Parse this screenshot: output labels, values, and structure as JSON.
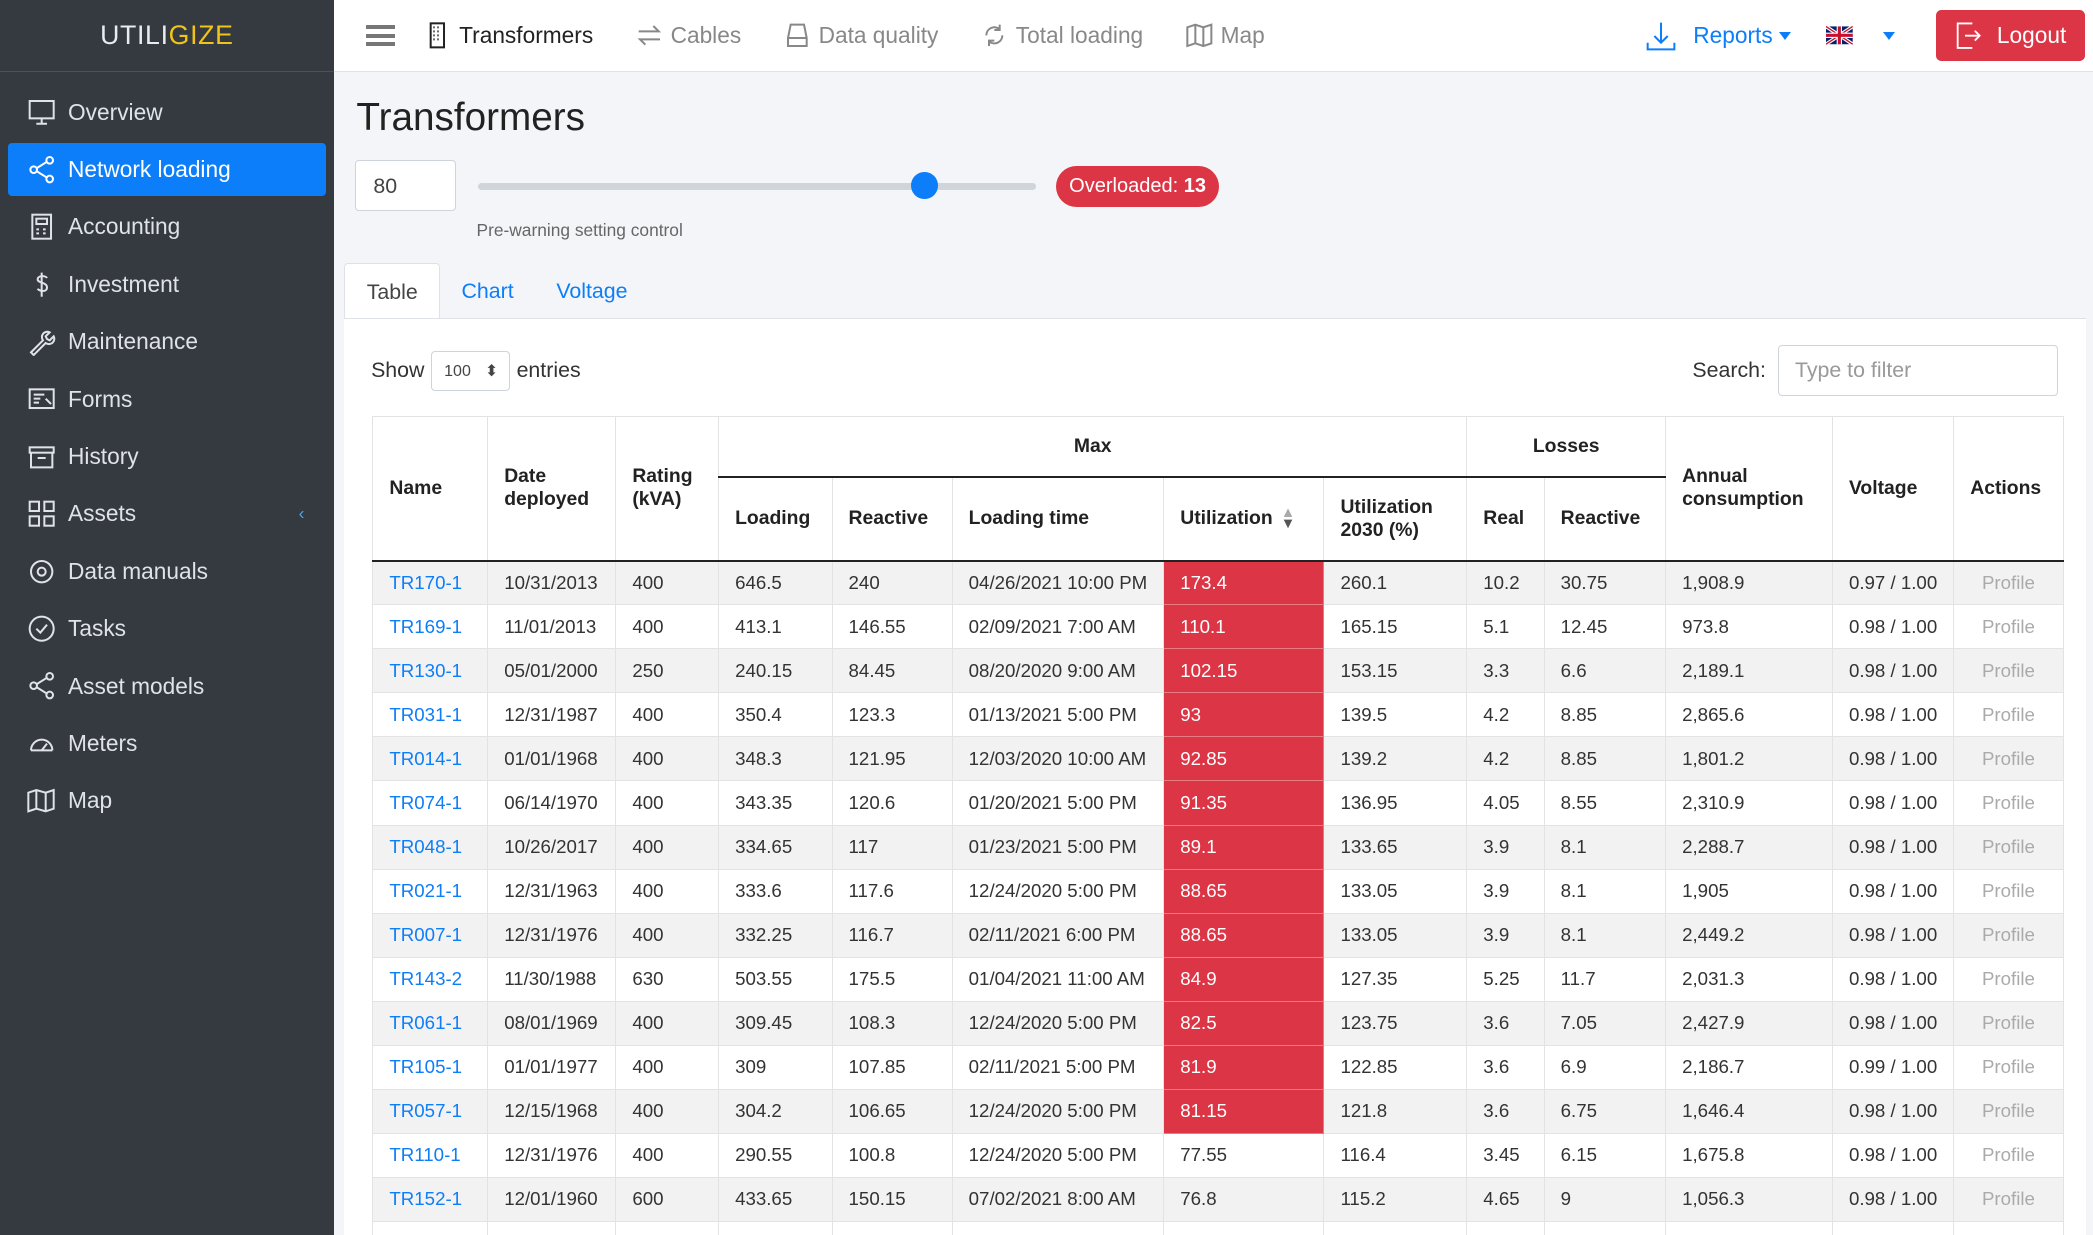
{
  "brand": {
    "part1": "UTILI",
    "part2": "GIZE"
  },
  "sidebar": {
    "items": [
      {
        "label": "Overview",
        "icon": "monitor-icon"
      },
      {
        "label": "Network loading",
        "icon": "share-nodes-icon",
        "active": true
      },
      {
        "label": "Accounting",
        "icon": "calculator-icon"
      },
      {
        "label": "Investment",
        "icon": "dollar-icon"
      },
      {
        "label": "Maintenance",
        "icon": "wrench-icon"
      },
      {
        "label": "Forms",
        "icon": "form-icon"
      },
      {
        "label": "History",
        "icon": "archive-icon"
      },
      {
        "label": "Assets",
        "icon": "grid-icon",
        "chevron": "‹"
      },
      {
        "label": "Data manuals",
        "icon": "gear-icon"
      },
      {
        "label": "Tasks",
        "icon": "check-circle-icon"
      },
      {
        "label": "Asset models",
        "icon": "share-nodes-icon"
      },
      {
        "label": "Meters",
        "icon": "gauge-icon"
      },
      {
        "label": "Map",
        "icon": "map-icon"
      }
    ]
  },
  "topnav": {
    "items": [
      {
        "label": "Transformers",
        "active": true
      },
      {
        "label": "Cables"
      },
      {
        "label": "Data quality"
      },
      {
        "label": "Total loading"
      },
      {
        "label": "Map"
      }
    ],
    "reports": "Reports",
    "language": "en-GB",
    "logout": "Logout"
  },
  "colors": {
    "accent": "#0d7ef9",
    "danger": "#dc3545",
    "sidebar": "#343a40"
  },
  "page": {
    "title": "Transformers",
    "threshold": "80",
    "slider_value": 80,
    "slider_max": 100,
    "overloaded_label": "Overloaded:",
    "overloaded_count": "13",
    "hint": "Pre-warning setting control",
    "tabs": [
      "Table",
      "Chart",
      "Voltage"
    ]
  },
  "table_controls": {
    "show": "Show",
    "entries_value": "100",
    "entries": "entries",
    "search_label": "Search:",
    "search_placeholder": "Type to filter"
  },
  "table": {
    "headers": {
      "name": "Name",
      "date": "Date deployed",
      "rating": "Rating (kVA)",
      "max": "Max",
      "loading": "Loading",
      "reactive": "Reactive",
      "loading_time": "Loading time",
      "utilization": "Utilization",
      "util2030": "Utilization 2030 (%)",
      "losses": "Losses",
      "real": "Real",
      "losses_reactive": "Reactive",
      "annual": "Annual consumption",
      "voltage": "Voltage",
      "actions": "Actions"
    },
    "rows": [
      [
        "TR170-1",
        "10/31/2013",
        "400",
        "646.5",
        "240",
        "04/26/2021 10:00 PM",
        "173.4",
        "260.1",
        "10.2",
        "30.75",
        "1,908.9",
        "0.97 / 1.00",
        "Profile"
      ],
      [
        "TR169-1",
        "11/01/2013",
        "400",
        "413.1",
        "146.55",
        "02/09/2021 7:00 AM",
        "110.1",
        "165.15",
        "5.1",
        "12.45",
        "973.8",
        "0.98 / 1.00",
        "Profile"
      ],
      [
        "TR130-1",
        "05/01/2000",
        "250",
        "240.15",
        "84.45",
        "08/20/2020 9:00 AM",
        "102.15",
        "153.15",
        "3.3",
        "6.6",
        "2,189.1",
        "0.98 / 1.00",
        "Profile"
      ],
      [
        "TR031-1",
        "12/31/1987",
        "400",
        "350.4",
        "123.3",
        "01/13/2021 5:00 PM",
        "93",
        "139.5",
        "4.2",
        "8.85",
        "2,865.6",
        "0.98 / 1.00",
        "Profile"
      ],
      [
        "TR014-1",
        "01/01/1968",
        "400",
        "348.3",
        "121.95",
        "12/03/2020 10:00 AM",
        "92.85",
        "139.2",
        "4.2",
        "8.85",
        "1,801.2",
        "0.98 / 1.00",
        "Profile"
      ],
      [
        "TR074-1",
        "06/14/1970",
        "400",
        "343.35",
        "120.6",
        "01/20/2021 5:00 PM",
        "91.35",
        "136.95",
        "4.05",
        "8.55",
        "2,310.9",
        "0.98 / 1.00",
        "Profile"
      ],
      [
        "TR048-1",
        "10/26/2017",
        "400",
        "334.65",
        "117",
        "01/23/2021 5:00 PM",
        "89.1",
        "133.65",
        "3.9",
        "8.1",
        "2,288.7",
        "0.98 / 1.00",
        "Profile"
      ],
      [
        "TR021-1",
        "12/31/1963",
        "400",
        "333.6",
        "117.6",
        "12/24/2020 5:00 PM",
        "88.65",
        "133.05",
        "3.9",
        "8.1",
        "1,905",
        "0.98 / 1.00",
        "Profile"
      ],
      [
        "TR007-1",
        "12/31/1976",
        "400",
        "332.25",
        "116.7",
        "02/11/2021 6:00 PM",
        "88.65",
        "133.05",
        "3.9",
        "8.1",
        "2,449.2",
        "0.98 / 1.00",
        "Profile"
      ],
      [
        "TR143-2",
        "11/30/1988",
        "630",
        "503.55",
        "175.5",
        "01/04/2021 11:00 AM",
        "84.9",
        "127.35",
        "5.25",
        "11.7",
        "2,031.3",
        "0.98 / 1.00",
        "Profile"
      ],
      [
        "TR061-1",
        "08/01/1969",
        "400",
        "309.45",
        "108.3",
        "12/24/2020 5:00 PM",
        "82.5",
        "123.75",
        "3.6",
        "7.05",
        "2,427.9",
        "0.98 / 1.00",
        "Profile"
      ],
      [
        "TR105-1",
        "01/01/1977",
        "400",
        "309",
        "107.85",
        "02/11/2021 5:00 PM",
        "81.9",
        "122.85",
        "3.6",
        "6.9",
        "2,186.7",
        "0.99 / 1.00",
        "Profile"
      ],
      [
        "TR057-1",
        "12/15/1968",
        "400",
        "304.2",
        "106.65",
        "12/24/2020 5:00 PM",
        "81.15",
        "121.8",
        "3.6",
        "6.75",
        "1,646.4",
        "0.98 / 1.00",
        "Profile"
      ],
      [
        "TR110-1",
        "12/31/1976",
        "400",
        "290.55",
        "100.8",
        "12/24/2020 5:00 PM",
        "77.55",
        "116.4",
        "3.45",
        "6.15",
        "1,675.8",
        "0.98 / 1.00",
        "Profile"
      ],
      [
        "TR152-1",
        "12/01/1960",
        "600",
        "433.65",
        "150.15",
        "07/02/2021 8:00 AM",
        "76.8",
        "115.2",
        "4.65",
        "9",
        "1,056.3",
        "0.98 / 1.00",
        "Profile"
      ],
      [
        "",
        "",
        "",
        "",
        "",
        "",
        "",
        "",
        "",
        "",
        "",
        "",
        ""
      ]
    ]
  }
}
